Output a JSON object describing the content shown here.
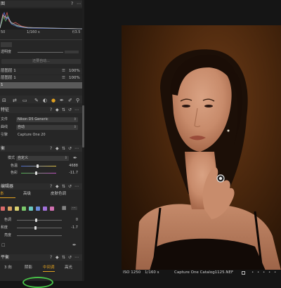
{
  "histogram": {
    "title": "图",
    "readout_left": "50",
    "readout_mid": "1/160 s",
    "readout_right": "f/3.5"
  },
  "exposure_row": {
    "label": "透明度"
  },
  "auto_button": {
    "label": "还要自动..."
  },
  "layers": {
    "items": [
      {
        "name": "层图层 1",
        "opacity": "100%"
      },
      {
        "name": "层图层 1",
        "opacity": "100%"
      }
    ],
    "selected": "1"
  },
  "base_characteristics": {
    "title": "特征",
    "rows": [
      {
        "label": "文件",
        "value": "Nikon D5 Generic"
      },
      {
        "label": "曲线",
        "value": "自动"
      },
      {
        "label": "引擎",
        "value": "Capture One 20"
      }
    ]
  },
  "white_balance": {
    "title": "衡",
    "mode_label": "模式",
    "mode_value": "自定义",
    "rows": [
      {
        "label": "色温",
        "value": "4688"
      },
      {
        "label": "色彩",
        "value": "-11.7"
      }
    ]
  },
  "color_editor": {
    "title": "编辑器",
    "tabs": [
      "本",
      "高级",
      "皮肤色调"
    ],
    "sliders": [
      {
        "label": "色调",
        "value": "0"
      },
      {
        "label": "和度",
        "value": "-1.7"
      },
      {
        "label": "亮度",
        "value": ""
      }
    ],
    "swatches": [
      "#d96a6a",
      "#d9a060",
      "#d8d070",
      "#7ac86a",
      "#6ac8c0",
      "#6a8ad8",
      "#a070d8",
      "#d070b0"
    ]
  },
  "balance_section": {
    "title": "平衡",
    "tabs": [
      "3 向",
      "阴影",
      "中间调",
      "高光"
    ],
    "active_tab": "中间调"
  },
  "status": {
    "iso": "ISO 1250",
    "shutter": "1/160 s",
    "filename": "Capture One Catalog1125.NEF"
  },
  "colors": {
    "accent": "#e0a020",
    "panel": "#262626",
    "canvas": "#151515"
  }
}
